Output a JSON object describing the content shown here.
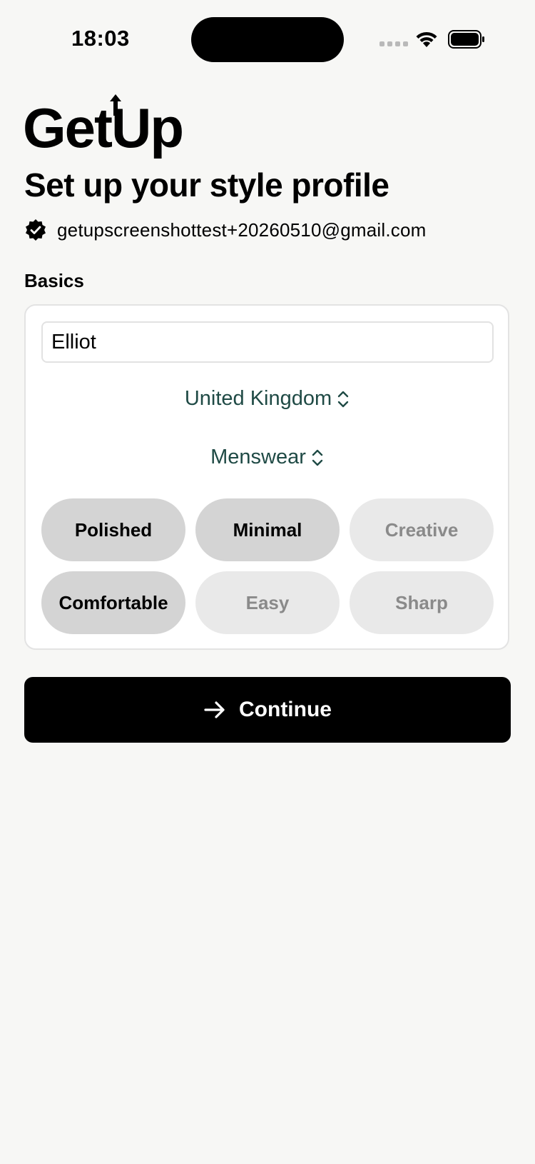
{
  "status_bar": {
    "time": "18:03"
  },
  "header": {
    "logo_text": "GetUp",
    "title": "Set up your style profile",
    "email": "getupscreenshottest+20260510@gmail.com",
    "verified_icon": "verified-badge-icon"
  },
  "basics": {
    "section_label": "Basics",
    "name_value": "Elliot",
    "country": "United Kingdom",
    "category": "Menswear",
    "styles": [
      {
        "label": "Polished",
        "selected": true
      },
      {
        "label": "Minimal",
        "selected": true
      },
      {
        "label": "Creative",
        "selected": false
      },
      {
        "label": "Comfortable",
        "selected": true
      },
      {
        "label": "Easy",
        "selected": false
      },
      {
        "label": "Sharp",
        "selected": false
      }
    ]
  },
  "actions": {
    "continue_label": "Continue",
    "continue_icon": "arrow-right-icon"
  },
  "colors": {
    "background": "#f7f7f5",
    "accent_text": "#1f4a45",
    "chip_selected": "#d4d4d4",
    "chip_unselected": "#e9e9e9",
    "button": "#000000"
  }
}
